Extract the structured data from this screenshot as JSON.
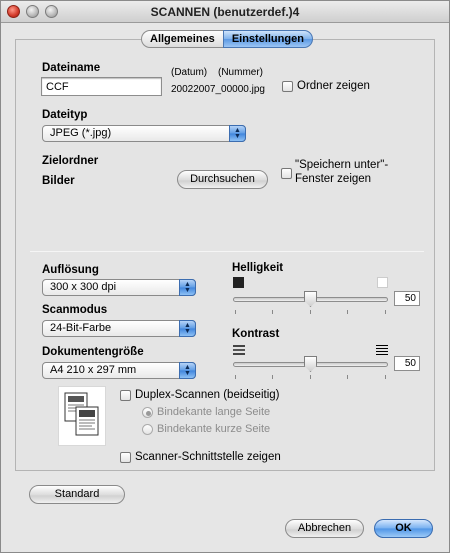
{
  "window": {
    "title": "SCANNEN (benutzerdef.)4"
  },
  "tabs": [
    {
      "label": "Allgemeines",
      "active": false
    },
    {
      "label": "Einstellungen",
      "active": true
    }
  ],
  "file": {
    "label": "Dateiname",
    "value": "CCF",
    "date_label": "(Datum)",
    "number_label": "(Nummer)",
    "example_name": "20022007_00000.jpg",
    "show_folder_label": "Ordner zeigen"
  },
  "filetype": {
    "label": "Dateityp",
    "value": "JPEG (*.jpg)"
  },
  "target": {
    "label": "Zielordner",
    "value": "Bilder",
    "browse_label": "Durchsuchen",
    "save_as_line1": "\"Speichern unter\"-",
    "save_as_line2": "Fenster zeigen"
  },
  "resolution": {
    "label": "Auflösung",
    "value": "300 x 300 dpi"
  },
  "scanmode": {
    "label": "Scanmodus",
    "value": "24-Bit-Farbe"
  },
  "docsize": {
    "label": "Dokumentengröße",
    "value": "A4  210 x 297 mm"
  },
  "brightness": {
    "label": "Helligkeit",
    "value": "50",
    "level": 0.5,
    "dark_icon": "dark-square-icon",
    "light_icon": "light-square-icon"
  },
  "contrast": {
    "label": "Kontrast",
    "value": "50",
    "level": 0.5,
    "low_icon": "low-contrast-icon",
    "high_icon": "high-contrast-icon"
  },
  "duplex": {
    "label": "Duplex-Scannen (beidseitig)",
    "long_edge_label": "Bindekante lange Seite",
    "short_edge_label": "Bindekante kurze Seite",
    "preview_icon": "duplex-pages-icon"
  },
  "scanner_ui": {
    "label": "Scanner-Schnittstelle zeigen"
  },
  "buttons": {
    "default_label": "Standard",
    "cancel_label": "Abbrechen",
    "ok_label": "OK"
  },
  "colors": {
    "accent": "#5b98e3",
    "panel": "#e4e4e4"
  }
}
